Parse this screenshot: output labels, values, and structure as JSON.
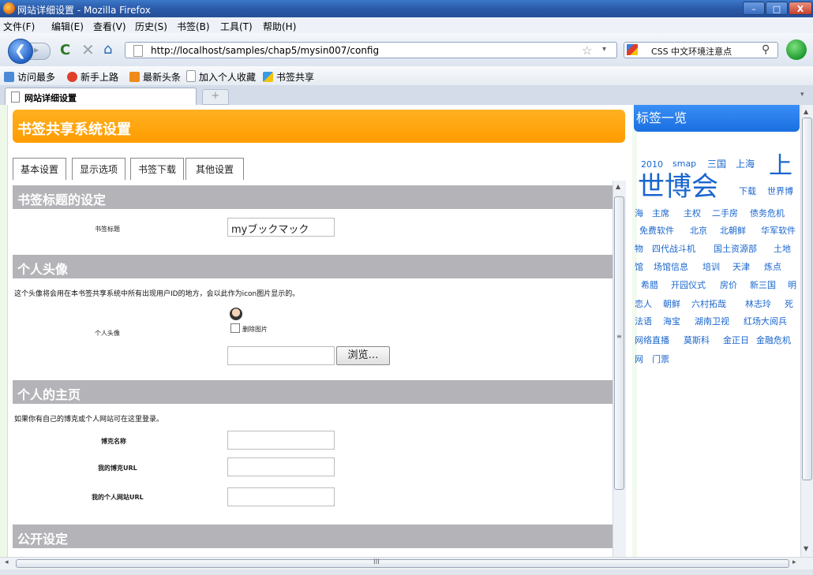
{
  "window": {
    "title": "网站详细设置 - Mozilla Firefox",
    "min": "–",
    "max": "□",
    "close": "X"
  },
  "menu": [
    "文件(F)",
    "编辑(E)",
    "查看(V)",
    "历史(S)",
    "书签(B)",
    "工具(T)",
    "帮助(H)"
  ],
  "nav": {
    "back": "❮",
    "fwd": "▸",
    "reload": "C",
    "stop": "✕",
    "home": "⌂",
    "url": "http://localhost/samples/chap5/mysin007/config",
    "star": "☆",
    "drop": "▾",
    "search_text": "CSS 中文环境注意点",
    "search_icon": "⚲"
  },
  "bookmarks": [
    "访问最多",
    "新手上路",
    "最新头条",
    "加入个人收藏",
    "书签共享"
  ],
  "tabs": {
    "active": "网站详细设置",
    "new": "+",
    "list": "▾"
  },
  "page": {
    "header": "书签共享系统设置",
    "tabs": [
      "基本设置",
      "显示选项",
      "书签下载",
      "其他设置"
    ],
    "sections": {
      "bookmark_title": {
        "heading": "书签标题的设定",
        "label": "书签标题",
        "value": "myブックマック"
      },
      "avatar": {
        "heading": "个人头像",
        "desc": "这个头像将会用在本书签共享系统中所有出现用户ID的地方，会以此作为icon图片显示的。",
        "label": "个人头像",
        "delete_label": "删除图片",
        "browse": "浏览…"
      },
      "homepage": {
        "heading": "个人的主页",
        "desc": "如果你有自己的博克或个人网站可在这里登录。",
        "blog_name": "博克名称",
        "blog_url": "我的博克URL",
        "site_url": "我的个人网站URL"
      },
      "public": {
        "heading": "公开设定"
      }
    },
    "scroll_up": "▲",
    "scroll_down": "▼",
    "grip": "≡",
    "hgrip": "III",
    "hleft": "◂",
    "hright": "▸"
  },
  "sidebar": {
    "title": "标签一览",
    "tags": [
      "2010",
      "smap",
      "三国",
      "上海",
      "上",
      "世博会",
      "下载",
      "世界博",
      "海",
      "主席",
      "主权",
      "二手房",
      "债务危机",
      "免费软件",
      "北京",
      "北朝鲜",
      "华军软件",
      "物",
      "四代战斗机",
      "国土资源部",
      "土地",
      "馆",
      "场馆信息",
      "培训",
      "天津",
      "炼点",
      "希腊",
      "开园仪式",
      "房价",
      "新三国",
      "明",
      "恋人",
      "朝鲜",
      "六村拓哉",
      "林志玲",
      "死",
      "法语",
      "海宝",
      "湖南卫视",
      "红场大阅兵",
      "网络直播",
      "莫斯科",
      "金正日",
      "金融危机",
      "网",
      "门票"
    ]
  }
}
